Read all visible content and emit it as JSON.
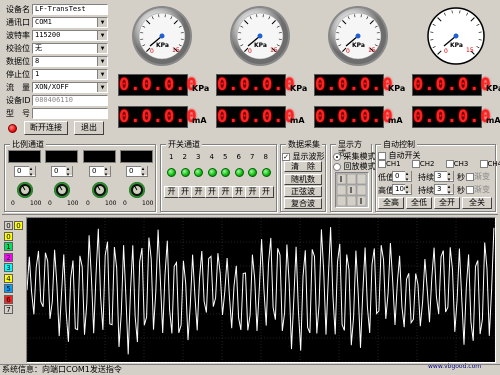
{
  "config": {
    "device_name_label": "设备名",
    "device_name_value": "LF-TransTest",
    "port_label": "通讯口",
    "port_value": "COM1",
    "baud_label": "波特率",
    "baud_value": "115200",
    "parity_label": "校验位",
    "parity_value": "无",
    "databits_label": "数据位",
    "databits_value": "8",
    "stopbits_label": "停止位",
    "stopbits_value": "1",
    "flow_label": "流　量",
    "flow_value": "XON/XOFF",
    "device_id_label": "设备ID",
    "device_id_value": "080406110",
    "model_label": "型　号",
    "model_value": "",
    "disconnect_label": "断开连接",
    "exit_label": "退出"
  },
  "gauges": [
    {
      "unit": "KPa",
      "scale_min": "0",
      "scale_max": "15"
    },
    {
      "unit": "KPa",
      "scale_min": "0",
      "scale_max": "15"
    },
    {
      "unit": "KPa",
      "scale_min": "0",
      "scale_max": "15"
    },
    {
      "unit": "KPa",
      "scale_min": "0",
      "scale_max": "15"
    }
  ],
  "displays": [
    {
      "kpa": "0.0.0.0",
      "kpa_unit": "KPa",
      "ma": "0.0.0.0",
      "ma_unit": "mA"
    },
    {
      "kpa": "0.0.0.0",
      "kpa_unit": "KPa",
      "ma": "0.0.0.0",
      "ma_unit": "mA"
    },
    {
      "kpa": "0.0.0.0",
      "kpa_unit": "KPa",
      "ma": "0.0.0.0",
      "ma_unit": "mA"
    },
    {
      "kpa": "0.0.0.0",
      "kpa_unit": "KPa",
      "ma": "0.0.0.0",
      "ma_unit": "mA"
    }
  ],
  "proportional": {
    "title": "比例通道",
    "channels": [
      {
        "value": "0",
        "min": "0",
        "max": "100"
      },
      {
        "value": "0",
        "min": "0",
        "max": "100"
      },
      {
        "value": "0",
        "min": "0",
        "max": "100"
      },
      {
        "value": "0",
        "min": "0",
        "max": "100"
      }
    ]
  },
  "switch": {
    "title": "开关通道",
    "numbers": [
      "1",
      "2",
      "3",
      "4",
      "5",
      "6",
      "7",
      "8"
    ],
    "buttons": [
      "开",
      "开",
      "开",
      "开",
      "开",
      "开",
      "开",
      "开"
    ]
  },
  "acquire": {
    "title": "数据采集",
    "show_wave": "显示波形",
    "clear": "清　除",
    "random": "随机数",
    "sine": "正弦波",
    "composite": "复合波"
  },
  "display_mode": {
    "title": "显示方式",
    "collect": "采集模式",
    "playback": "回放模式"
  },
  "auto": {
    "title": "自动控制",
    "auto_switch": "自动开关",
    "ch1": "CH1",
    "ch2": "CH2",
    "ch3": "CH3",
    "ch4": "CH4",
    "low": "低值",
    "low_val": "0",
    "high": "高值",
    "high_val": "100",
    "hold1": "持续",
    "hold1_val": "3",
    "hold2": "持续",
    "hold2_val": "3",
    "sec": "秒",
    "gradual": "渐变",
    "all_high": "全高",
    "all_low": "全低",
    "all_on": "全开",
    "all_off": "全关"
  },
  "channels": [
    {
      "num": "0",
      "color": "#d4d0c8"
    },
    {
      "num": "0",
      "color": "#ffff00"
    },
    {
      "num": "1",
      "color": "#00e060"
    },
    {
      "num": "2",
      "color": "#ff00ff"
    },
    {
      "num": "3",
      "color": "#00ffff"
    },
    {
      "num": "4",
      "color": "#ffff00"
    },
    {
      "num": "5",
      "color": "#00a0ff"
    },
    {
      "num": "6",
      "color": "#ff2020"
    },
    {
      "num": "7",
      "color": "#d4d0c8"
    }
  ],
  "status": {
    "text": "系统信息：向端口COM1发送指令"
  },
  "watermark": "www.vbgood.com"
}
